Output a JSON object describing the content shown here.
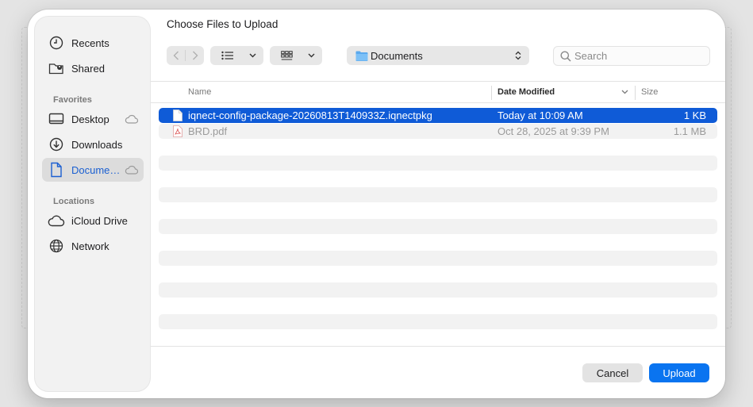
{
  "dialog": {
    "title": "Choose Files to Upload"
  },
  "sidebar": {
    "top_items": [
      {
        "label": "Recents",
        "icon": "clock-icon"
      },
      {
        "label": "Shared",
        "icon": "shared-folder-icon"
      }
    ],
    "favorites_heading": "Favorites",
    "favorites": [
      {
        "label": "Desktop",
        "icon": "desktop-icon",
        "cloud": true
      },
      {
        "label": "Downloads",
        "icon": "downloads-icon",
        "cloud": false
      },
      {
        "label": "Docume…",
        "icon": "document-icon",
        "cloud": true,
        "active": true
      }
    ],
    "locations_heading": "Locations",
    "locations": [
      {
        "label": "iCloud Drive",
        "icon": "icloud-icon"
      },
      {
        "label": "Network",
        "icon": "network-icon"
      }
    ]
  },
  "toolbar": {
    "location": "Documents",
    "search_placeholder": "Search"
  },
  "columns": {
    "name": "Name",
    "date": "Date Modified",
    "size": "Size"
  },
  "files": [
    {
      "name": "iqnect-config-package-20260813T140933Z.iqnectpkg",
      "date": "Today at 10:09 AM",
      "size": "1 KB",
      "selected": true
    },
    {
      "name": "BRD.pdf",
      "date": "Oct 28, 2025 at 9:39 PM",
      "size": "1.1 MB",
      "selected": false
    }
  ],
  "buttons": {
    "cancel": "Cancel",
    "upload": "Upload"
  },
  "colors": {
    "accent": "#0a74f0",
    "selection": "#0f5bd7"
  }
}
